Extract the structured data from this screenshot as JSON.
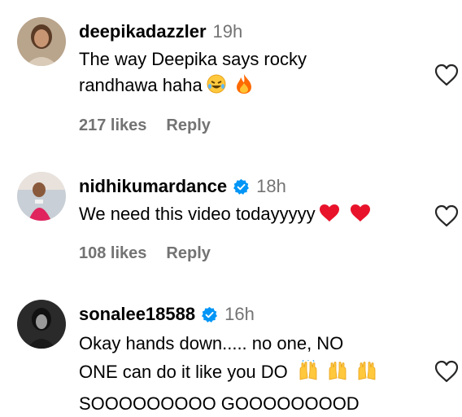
{
  "comments": [
    {
      "avatar": "avatar-deepikadazzler",
      "username": "deepikadazzler",
      "verified": false,
      "time": "19h",
      "text_line1": "The way Deepika says rocky",
      "text_line2": "randhawa haha",
      "emojis": [
        "rolling-laugh-emoji",
        "fire-emoji"
      ],
      "likes": "217 likes",
      "reply": "Reply"
    },
    {
      "avatar": "avatar-nidhikumardance",
      "username": "nidhikumardance",
      "verified": true,
      "time": "18h",
      "text_line1": "We need this video todayyyyy",
      "emojis": [
        "red-heart-emoji",
        "red-heart-emoji"
      ],
      "likes": "108 likes",
      "reply": "Reply"
    },
    {
      "avatar": "avatar-sonalee18588",
      "username": "sonalee18588",
      "verified": true,
      "time": "16h",
      "text_line1": "Okay hands down..... no one, NO",
      "text_line2": "ONE can do it like you DO",
      "text_line3": "SOOOOOOOOO GOOOOOOOOD",
      "emojis": [
        "raising-hands-emoji",
        "raising-hands-emoji",
        "raising-hands-emoji"
      ]
    }
  ],
  "colors": {
    "secondary_text": "#737373",
    "verified_blue": "#0095f6",
    "heart_outline": "#262626"
  },
  "icons": {
    "like": "heart-outline-icon",
    "verified": "verified-badge-icon"
  }
}
